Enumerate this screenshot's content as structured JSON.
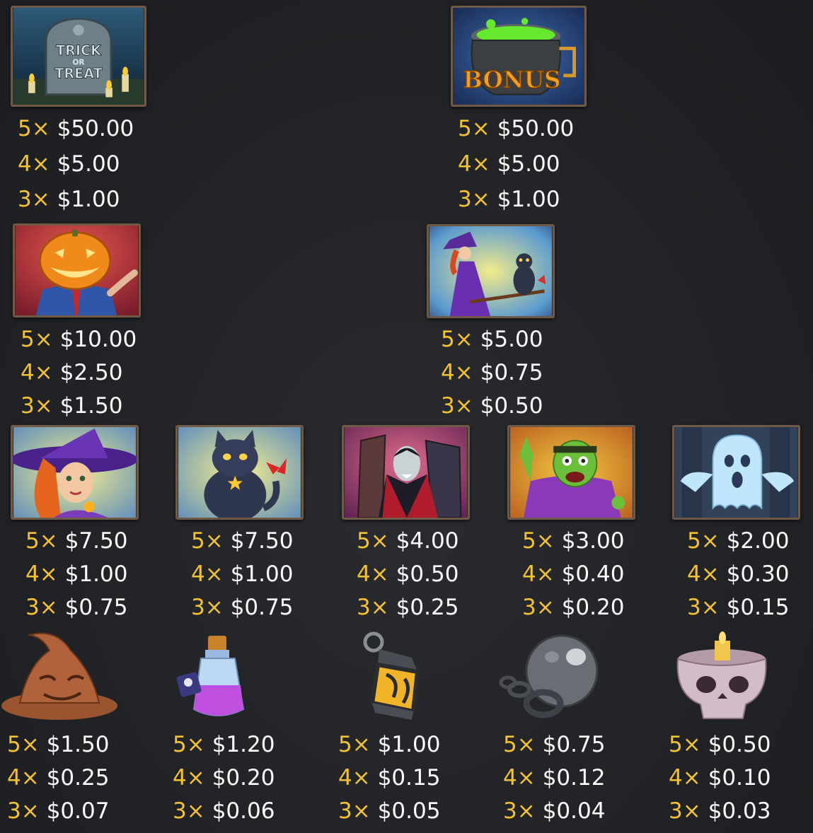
{
  "paytable": {
    "symbols": [
      {
        "name": "trick-or-treat-tombstone",
        "art_text": [
          "TRICK",
          "OR",
          "TREAT"
        ],
        "pays": [
          {
            "count": "5×",
            "amount": "$50.00"
          },
          {
            "count": "4×",
            "amount": "$5.00"
          },
          {
            "count": "3×",
            "amount": "$1.00"
          }
        ]
      },
      {
        "name": "bonus-cauldron",
        "art_text": [
          "BONUS"
        ],
        "pays": [
          {
            "count": "5×",
            "amount": "$50.00"
          },
          {
            "count": "4×",
            "amount": "$5.00"
          },
          {
            "count": "3×",
            "amount": "$1.00"
          }
        ]
      },
      {
        "name": "pumpkin-head",
        "pays": [
          {
            "count": "5×",
            "amount": "$10.00"
          },
          {
            "count": "4×",
            "amount": "$2.50"
          },
          {
            "count": "3×",
            "amount": "$1.50"
          }
        ]
      },
      {
        "name": "witch-with-cat",
        "pays": [
          {
            "count": "5×",
            "amount": "$5.00"
          },
          {
            "count": "4×",
            "amount": "$0.75"
          },
          {
            "count": "3×",
            "amount": "$0.50"
          }
        ]
      },
      {
        "name": "witch",
        "pays": [
          {
            "count": "5×",
            "amount": "$7.50"
          },
          {
            "count": "4×",
            "amount": "$1.00"
          },
          {
            "count": "3×",
            "amount": "$0.75"
          }
        ]
      },
      {
        "name": "black-cat",
        "pays": [
          {
            "count": "5×",
            "amount": "$7.50"
          },
          {
            "count": "4×",
            "amount": "$1.00"
          },
          {
            "count": "3×",
            "amount": "$0.75"
          }
        ]
      },
      {
        "name": "vampire",
        "pays": [
          {
            "count": "5×",
            "amount": "$4.00"
          },
          {
            "count": "4×",
            "amount": "$0.50"
          },
          {
            "count": "3×",
            "amount": "$0.25"
          }
        ]
      },
      {
        "name": "zombie",
        "pays": [
          {
            "count": "5×",
            "amount": "$3.00"
          },
          {
            "count": "4×",
            "amount": "$0.40"
          },
          {
            "count": "3×",
            "amount": "$0.20"
          }
        ]
      },
      {
        "name": "ghost",
        "pays": [
          {
            "count": "5×",
            "amount": "$2.00"
          },
          {
            "count": "4×",
            "amount": "$0.30"
          },
          {
            "count": "3×",
            "amount": "$0.15"
          }
        ]
      },
      {
        "name": "witch-hat",
        "pays": [
          {
            "count": "5×",
            "amount": "$1.50"
          },
          {
            "count": "4×",
            "amount": "$0.25"
          },
          {
            "count": "3×",
            "amount": "$0.07"
          }
        ]
      },
      {
        "name": "potion-bottle",
        "pays": [
          {
            "count": "5×",
            "amount": "$1.20"
          },
          {
            "count": "4×",
            "amount": "$0.20"
          },
          {
            "count": "3×",
            "amount": "$0.06"
          }
        ]
      },
      {
        "name": "lantern",
        "pays": [
          {
            "count": "5×",
            "amount": "$1.00"
          },
          {
            "count": "4×",
            "amount": "$0.15"
          },
          {
            "count": "3×",
            "amount": "$0.05"
          }
        ]
      },
      {
        "name": "ball-and-chain",
        "pays": [
          {
            "count": "5×",
            "amount": "$0.75"
          },
          {
            "count": "4×",
            "amount": "$0.12"
          },
          {
            "count": "3×",
            "amount": "$0.04"
          }
        ]
      },
      {
        "name": "skull-candle",
        "pays": [
          {
            "count": "5×",
            "amount": "$0.50"
          },
          {
            "count": "4×",
            "amount": "$0.10"
          },
          {
            "count": "3×",
            "amount": "$0.03"
          }
        ]
      }
    ]
  }
}
